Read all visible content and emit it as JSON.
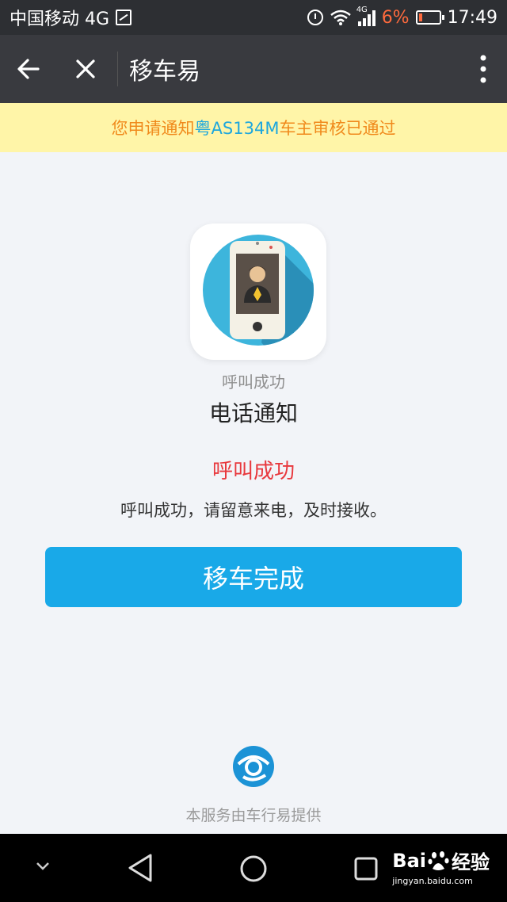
{
  "status_bar": {
    "carrier": "中国移动 4G",
    "network_badge": "4G",
    "battery_pct": "6%",
    "time": "17:49"
  },
  "title_bar": {
    "title": "移车易"
  },
  "notice": {
    "prefix": "您申请通知",
    "plate": "粤AS134M",
    "suffix": "车主审核已通过"
  },
  "content": {
    "caption": "呼叫成功",
    "title": "电话通知",
    "status": "呼叫成功",
    "description": "呼叫成功，请留意来电，及时接收。",
    "button_label": "移车完成"
  },
  "footer": {
    "provider": "本服务由车行易提供"
  },
  "watermark": {
    "brand": "Bai",
    "brand2": "经验",
    "url": "jingyan.baidu.com"
  },
  "colors": {
    "accent": "#19a9e8",
    "notice_text": "#f08a1c",
    "plate": "#1ea7dd",
    "status_red": "#e8383d"
  }
}
